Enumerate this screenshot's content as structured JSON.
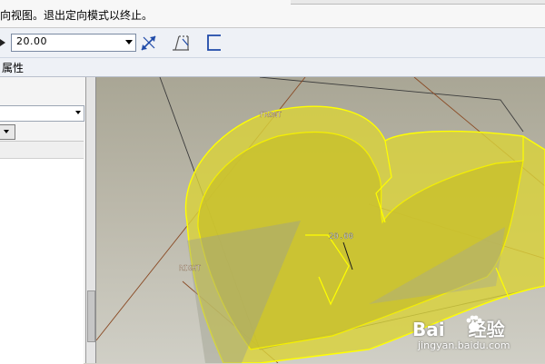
{
  "status": {
    "message": "向视图。退出定向模式以终止。"
  },
  "toolbar": {
    "depth_value": "20.00",
    "icons": [
      "flip-arrow-icon",
      "taper-icon",
      "side-option-icon"
    ]
  },
  "tabs": {
    "properties_label": "属性"
  },
  "viewport": {
    "datum_front": "FRONT",
    "datum_right": "RIGHT",
    "dimension_value": "20.00",
    "feature_color": "#d9d23a",
    "edge_color": "#ffff00"
  },
  "watermark": {
    "brand_left": "Bai",
    "brand_right": "经验",
    "url": "jingyan.baidu.com"
  }
}
